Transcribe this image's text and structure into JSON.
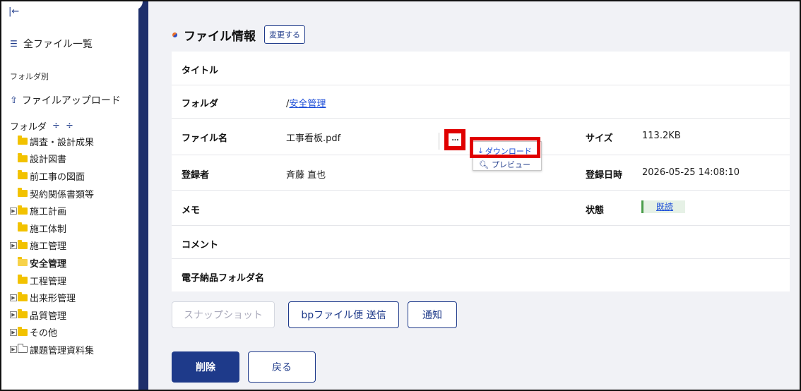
{
  "sidebar": {
    "collapse_icon": "collapse-left-icon",
    "all_files": "全ファイル一覧",
    "section_label": "フォルダ別",
    "upload": "ファイルアップロード",
    "folder_heading": "フォルダ",
    "folders": [
      {
        "label": "調査・設計成果",
        "expandable": false
      },
      {
        "label": "設計図書",
        "expandable": false
      },
      {
        "label": "前工事の図面",
        "expandable": false
      },
      {
        "label": "契約関係書類等",
        "expandable": false
      },
      {
        "label": "施工計画",
        "expandable": true
      },
      {
        "label": "施工体制",
        "expandable": false
      },
      {
        "label": "施工管理",
        "expandable": true
      },
      {
        "label": "安全管理",
        "expandable": false,
        "active": true
      },
      {
        "label": "工程管理",
        "expandable": false
      },
      {
        "label": "出来形管理",
        "expandable": true
      },
      {
        "label": "品質管理",
        "expandable": true
      },
      {
        "label": "その他",
        "expandable": true
      },
      {
        "label": "課題管理資料集",
        "expandable": true,
        "empty": true
      }
    ]
  },
  "header": {
    "title": "ファイル情報",
    "change_button": "変更する"
  },
  "fields": {
    "title_label": "タイトル",
    "folder_label": "フォルダ",
    "folder_prefix": "/",
    "folder_value": "安全管理",
    "filename_label": "ファイル名",
    "filename_value": "工事看板.pdf",
    "size_label": "サイズ",
    "size_value": "113.2KB",
    "registrant_label": "登録者",
    "registrant_value": "斉藤 直也",
    "registered_at_label": "登録日時",
    "registered_at_value": "2026-05-25 14:08:10",
    "memo_label": "メモ",
    "status_label": "状態",
    "status_value": "既読",
    "comment_label": "コメント",
    "e_delivery_label": "電子納品フォルダ名"
  },
  "file_menu": {
    "more": "…",
    "download": "ダウンロード",
    "preview": "プレビュー"
  },
  "actions": {
    "snapshot": "スナップショット",
    "bp_send": "bpファイル便 送信",
    "notify": "通知",
    "delete": "削除",
    "back": "戻る"
  },
  "colors": {
    "accent": "#1e3a8a",
    "highlight": "#e00000",
    "status_bg": "#e6f1e6"
  }
}
